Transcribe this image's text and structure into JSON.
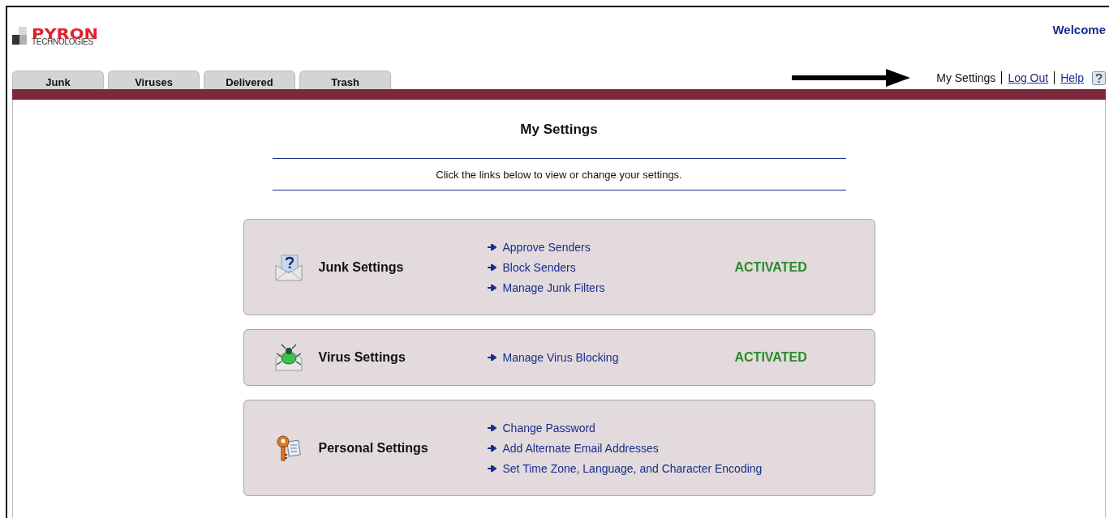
{
  "logo": {
    "name": "PYRON",
    "subtitle": "TECHNOLOGIES"
  },
  "welcome": "Welcome",
  "tabs": [
    {
      "label": "Junk",
      "selected": false
    },
    {
      "label": "Viruses",
      "selected": false
    },
    {
      "label": "Delivered",
      "selected": false
    },
    {
      "label": "Trash",
      "selected": false
    }
  ],
  "top_links": [
    {
      "label": "My Settings",
      "kind": "current"
    },
    {
      "label": "Log Out",
      "kind": "link"
    },
    {
      "label": "Help",
      "kind": "link"
    }
  ],
  "page": {
    "title": "My Settings",
    "intro": "Click the links below to view or change your settings."
  },
  "sections": [
    {
      "kind": "junk",
      "title": "Junk Settings",
      "links": [
        "Approve Senders",
        "Block Senders",
        "Manage Junk Filters"
      ],
      "status": "ACTIVATED"
    },
    {
      "kind": "virus",
      "title": "Virus Settings",
      "links": [
        "Manage Virus Blocking"
      ],
      "status": "ACTIVATED"
    },
    {
      "kind": "personal",
      "title": "Personal Settings",
      "links": [
        "Change Password",
        "Add Alternate Email Addresses",
        "Set Time Zone, Language, and Character Encoding"
      ]
    }
  ]
}
